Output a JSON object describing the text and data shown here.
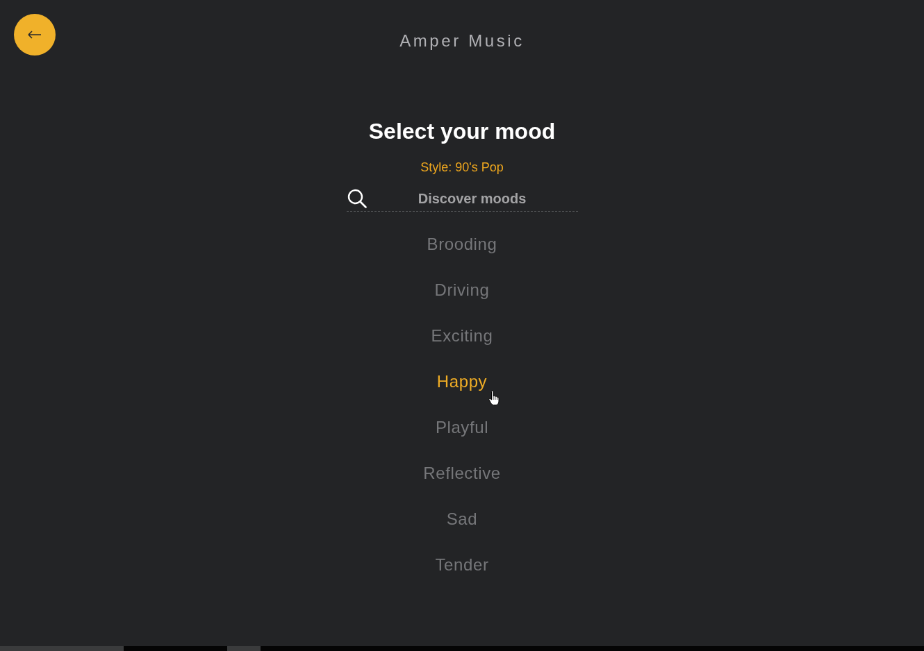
{
  "app_title": "Amper Music",
  "heading": "Select your mood",
  "style_label": "Style: 90's Pop",
  "search": {
    "placeholder": "Discover moods"
  },
  "moods": [
    {
      "label": "Brooding",
      "selected": false
    },
    {
      "label": "Driving",
      "selected": false
    },
    {
      "label": "Exciting",
      "selected": false
    },
    {
      "label": "Happy",
      "selected": true
    },
    {
      "label": "Playful",
      "selected": false
    },
    {
      "label": "Reflective",
      "selected": false
    },
    {
      "label": "Sad",
      "selected": false
    },
    {
      "label": "Tender",
      "selected": false
    }
  ]
}
